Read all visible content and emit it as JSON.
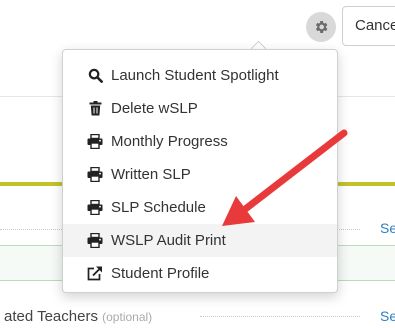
{
  "header": {
    "settings_icon": "gear-icon",
    "cancel_label": "Cancel"
  },
  "menu": {
    "items": [
      {
        "label": "Launch Student Spotlight",
        "icon": "search-icon"
      },
      {
        "label": "Delete wSLP",
        "icon": "trash-icon"
      },
      {
        "label": "Monthly Progress",
        "icon": "print-icon"
      },
      {
        "label": "Written SLP",
        "icon": "print-icon"
      },
      {
        "label": "SLP Schedule",
        "icon": "print-icon"
      },
      {
        "label": "WSLP Audit Print",
        "icon": "print-icon",
        "highlighted": true
      },
      {
        "label": "Student Profile",
        "icon": "external-link-icon"
      }
    ]
  },
  "background": {
    "row_link_label": "Se",
    "teachers_label": "ated Teachers",
    "teachers_optional": "(optional)",
    "teachers_link_label": "Se"
  },
  "colors": {
    "annotation_arrow": "#e83a3a",
    "olive_rule": "#c2c22a",
    "link": "#2f7fc1"
  }
}
